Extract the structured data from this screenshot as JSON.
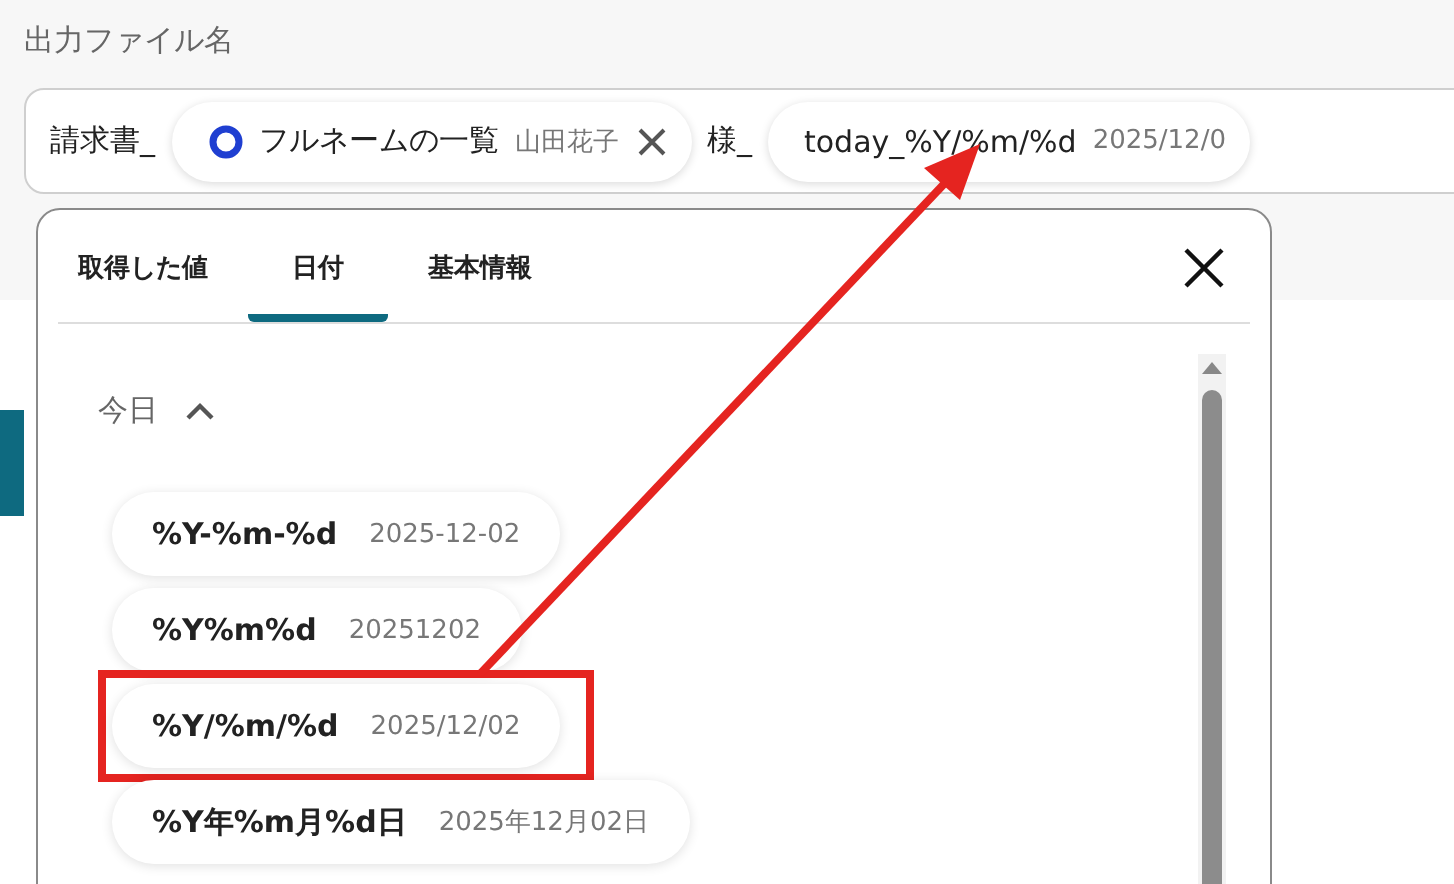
{
  "label": "出力ファイル名",
  "field": {
    "segments": [
      {
        "kind": "text",
        "text": "請求書_"
      },
      {
        "kind": "variable",
        "text": "フルネームの一覧",
        "value": "山田花子",
        "removable": true
      },
      {
        "kind": "text",
        "text": "様_"
      },
      {
        "kind": "date",
        "text": "today_%Y/%m/%d",
        "value": "2025/12/0",
        "removable": false
      }
    ]
  },
  "popup": {
    "tabs": [
      {
        "label": "取得した値",
        "selected": false
      },
      {
        "label": "日付",
        "selected": true
      },
      {
        "label": "基本情報",
        "selected": false
      }
    ],
    "section": {
      "title": "今日",
      "expanded": true
    },
    "items": [
      {
        "format": "%Y-%m-%d",
        "example": "2025-12-02",
        "highlighted": false
      },
      {
        "format": "%Y%m%d",
        "example": "20251202",
        "highlighted": false
      },
      {
        "format": "%Y/%m/%d",
        "example": "2025/12/02",
        "highlighted": true
      },
      {
        "format": "%Y年%m月%d日",
        "example": "2025年12月02日",
        "highlighted": false
      }
    ]
  }
}
